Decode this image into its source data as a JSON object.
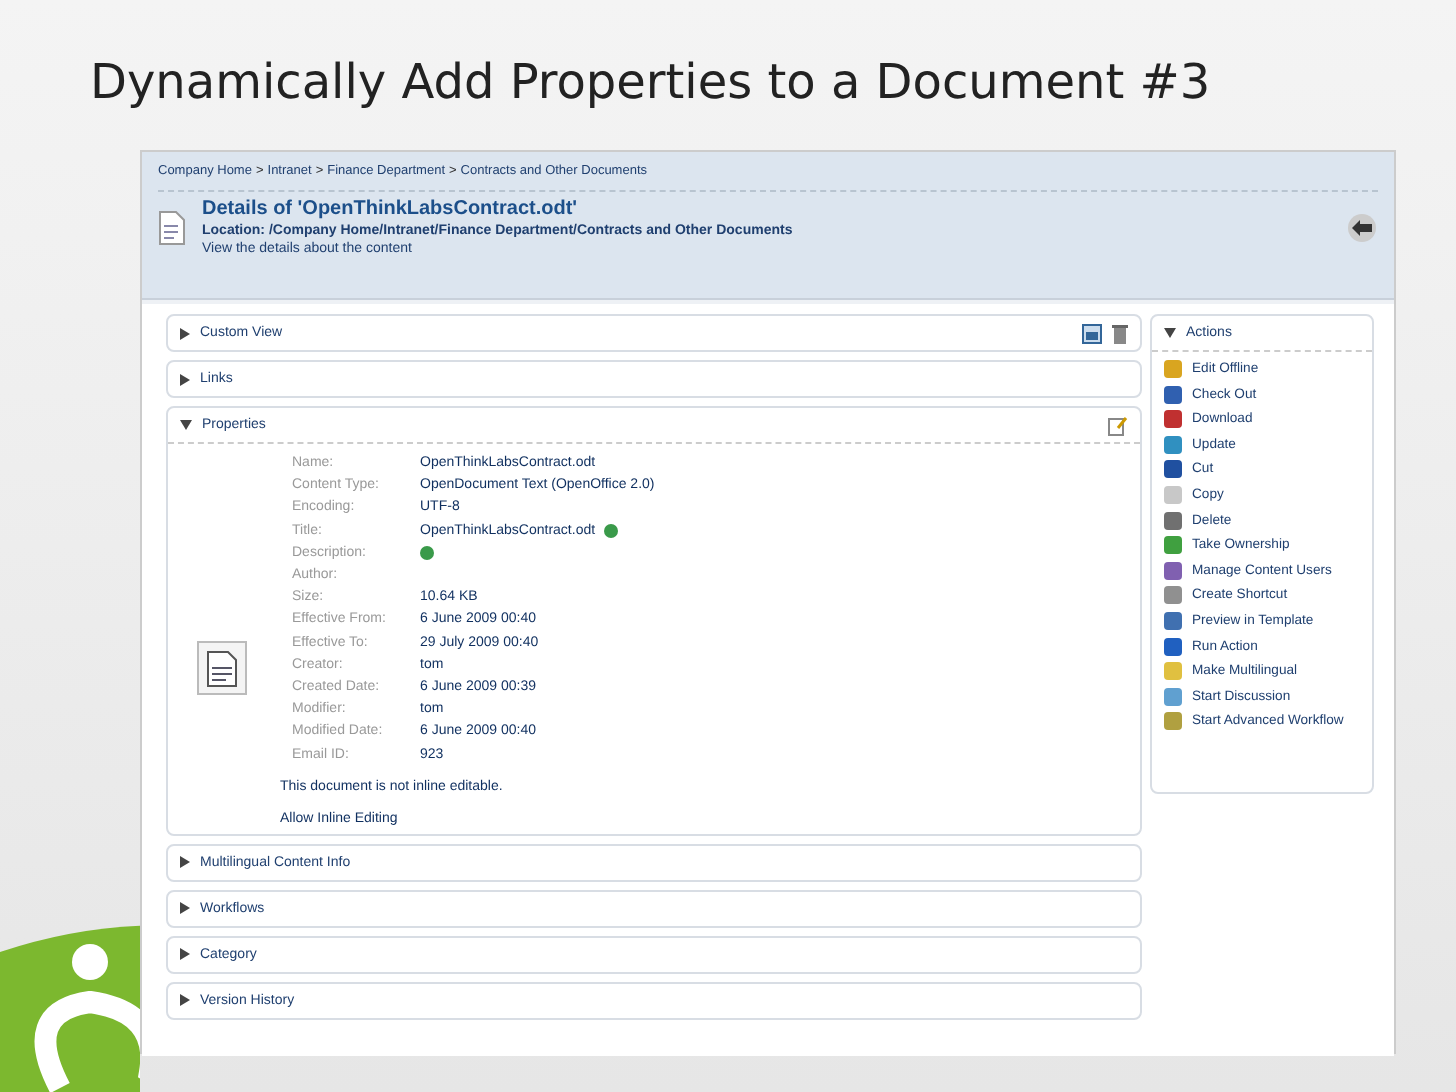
{
  "slide_title": "Dynamically Add Properties to a Document #3",
  "breadcrumb": [
    "Company Home",
    "Intranet",
    "Finance Department",
    "Contracts and Other Documents"
  ],
  "breadcrumb_separator": ">",
  "header": {
    "title": "Details of 'OpenThinkLabsContract.odt'",
    "location": "Location: /Company Home/Intranet/Finance Department/Contracts and Other Documents",
    "subtitle": "View the details about the content"
  },
  "sections": [
    {
      "title": "Custom View",
      "expanded": false,
      "kind": "custom_view"
    },
    {
      "title": "Links",
      "expanded": false,
      "kind": "plain"
    },
    {
      "title": "Properties",
      "expanded": true,
      "kind": "properties"
    },
    {
      "title": "Multilingual Content Info",
      "expanded": false,
      "kind": "plain"
    },
    {
      "title": "Workflows",
      "expanded": false,
      "kind": "plain"
    },
    {
      "title": "Category",
      "expanded": false,
      "kind": "plain"
    },
    {
      "title": "Version History",
      "expanded": false,
      "kind": "plain"
    }
  ],
  "properties": {
    "rows": [
      {
        "label": "Name:",
        "value": "OpenThinkLabsContract.odt",
        "edit_icon": false
      },
      {
        "label": "Content Type:",
        "value": "OpenDocument Text (OpenOffice 2.0)",
        "edit_icon": false
      },
      {
        "label": "Encoding:",
        "value": "UTF-8",
        "edit_icon": false
      },
      {
        "label": "Title:",
        "value": "OpenThinkLabsContract.odt",
        "edit_icon": true
      },
      {
        "label": "Description:",
        "value": "",
        "edit_icon": true
      },
      {
        "label": "Author:",
        "value": "",
        "edit_icon": false
      },
      {
        "label": "Size:",
        "value": "10.64 KB",
        "edit_icon": false
      },
      {
        "label": "Effective From:",
        "value": "6 June 2009 00:40",
        "edit_icon": false
      },
      {
        "label": "Effective To:",
        "value": "29 July 2009 00:40",
        "edit_icon": false
      },
      {
        "label": "Creator:",
        "value": "tom",
        "edit_icon": false
      },
      {
        "label": "Created Date:",
        "value": "6 June 2009 00:39",
        "edit_icon": false
      },
      {
        "label": "Modifier:",
        "value": "tom",
        "edit_icon": false
      },
      {
        "label": "Modified Date:",
        "value": "6 June 2009 00:40",
        "edit_icon": false
      },
      {
        "label": "Email ID:",
        "value": "923",
        "edit_icon": false
      }
    ],
    "note": "This document is not inline editable.",
    "link": "Allow Inline Editing"
  },
  "actions": {
    "title": "Actions",
    "expanded": true,
    "items": [
      {
        "label": "Edit Offline",
        "color": "#d9a520"
      },
      {
        "label": "Check Out",
        "color": "#3060b0"
      },
      {
        "label": "Download",
        "color": "#c03030"
      },
      {
        "label": "Update",
        "color": "#3090c0"
      },
      {
        "label": "Cut",
        "color": "#2050a0"
      },
      {
        "label": "Copy",
        "color": "#c8c8c8"
      },
      {
        "label": "Delete",
        "color": "#707070"
      },
      {
        "label": "Take Ownership",
        "color": "#40a040"
      },
      {
        "label": "Manage Content Users",
        "color": "#8060b0"
      },
      {
        "label": "Create Shortcut",
        "color": "#909090"
      },
      {
        "label": "Preview in Template",
        "color": "#4070b0"
      },
      {
        "label": "Run Action",
        "color": "#2060c0"
      },
      {
        "label": "Make Multilingual",
        "color": "#e0c040"
      },
      {
        "label": "Start Discussion",
        "color": "#60a0d0"
      },
      {
        "label": "Start Advanced Workflow",
        "color": "#b0a040"
      }
    ]
  }
}
